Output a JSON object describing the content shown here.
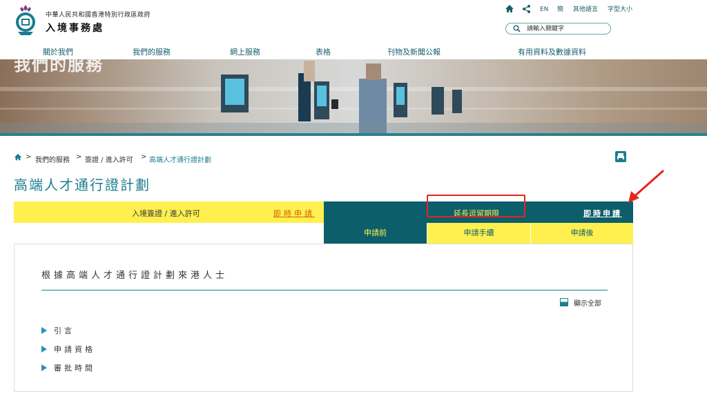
{
  "header": {
    "gov_name": "中華人民共和國香港特別行政區政府",
    "dept_name": "入境事務處",
    "utility": {
      "home_icon": "home-icon",
      "share_icon": "share-icon",
      "en": "EN",
      "simplified": "簡",
      "other_languages": "其他語言",
      "font_size": "字型大小"
    },
    "search": {
      "placeholder": "請輸入關鍵字",
      "icon": "search-icon"
    }
  },
  "nav": {
    "items": [
      "關於我們",
      "我們的服務",
      "網上服務",
      "表格",
      "刊物及新聞公報",
      "有用資料及數據資料"
    ]
  },
  "banner": {
    "title": "我們的服務"
  },
  "breadcrumb": {
    "home_icon": "home-icon",
    "items": [
      "我們的服務",
      "簽證 / 進入許可",
      "高端人才通行證計劃"
    ]
  },
  "page": {
    "title": "高端人才通行證計劃"
  },
  "tabs": {
    "left": {
      "label": "入境簽證 / 進入許可",
      "apply": "即時申請"
    },
    "right": {
      "label": "延長逗留期限",
      "apply": "即時申請"
    },
    "subtabs": [
      "申請前",
      "申請手續",
      "申請後"
    ]
  },
  "panel": {
    "heading": "根據高端人才通行證計劃來港人士",
    "show_all": "顯示全部",
    "items": [
      "引言",
      "申請資格",
      "審批時間"
    ]
  },
  "colors": {
    "teal": "#0d5e6b",
    "yellow": "#fff04f",
    "accent_orange": "#d95b00",
    "annotation_red": "#e8231c"
  }
}
